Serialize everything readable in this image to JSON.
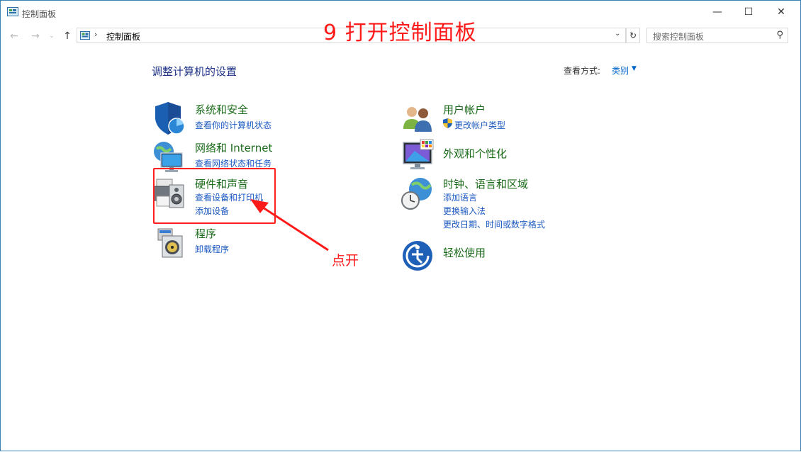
{
  "window": {
    "title": "控制面板",
    "minimize": "—",
    "maximize": "☐",
    "close": "✕"
  },
  "nav": {
    "back": "←",
    "forward": "→",
    "recent": "⌄",
    "up": "↑",
    "address_sep": "›",
    "address": "控制面板",
    "dropdown": "⌄",
    "refresh": "↻",
    "search_placeholder": "搜索控制面板",
    "search_glyph": "⚲"
  },
  "annotation": {
    "step_title": "9  打开控制面板",
    "click_hint": "点开",
    "color": "#ff1a1a"
  },
  "main": {
    "heading": "调整计算机的设置",
    "view_by_label": "查看方式:",
    "view_by_value": "类别",
    "view_by_arrow": "▼"
  },
  "categories": {
    "system": {
      "title": "系统和安全",
      "links": [
        "查看你的计算机状态"
      ],
      "icon": "shield-icon"
    },
    "network": {
      "title": "网络和 Internet",
      "links": [
        "查看网络状态和任务"
      ],
      "icon": "network-globe-icon"
    },
    "hardware": {
      "title": "硬件和声音",
      "links": [
        "查看设备和打印机",
        "添加设备"
      ],
      "icon": "printer-speaker-icon"
    },
    "programs": {
      "title": "程序",
      "links": [
        "卸载程序"
      ],
      "icon": "programs-disc-icon"
    },
    "users": {
      "title": "用户帐户",
      "links": [
        "更改帐户类型"
      ],
      "icon": "users-icon"
    },
    "appearance": {
      "title": "外观和个性化",
      "links": [],
      "icon": "monitor-palette-icon"
    },
    "clock": {
      "title": "时钟、语言和区域",
      "links": [
        "添加语言",
        "更换输入法",
        "更改日期、时间或数字格式"
      ],
      "icon": "clock-globe-icon"
    },
    "ease": {
      "title": "轻松使用",
      "links": [],
      "icon": "ease-of-access-icon"
    }
  },
  "colors": {
    "accent_link": "#1a58c0",
    "category_title": "#1a6b1a",
    "heading": "#1e3287"
  }
}
